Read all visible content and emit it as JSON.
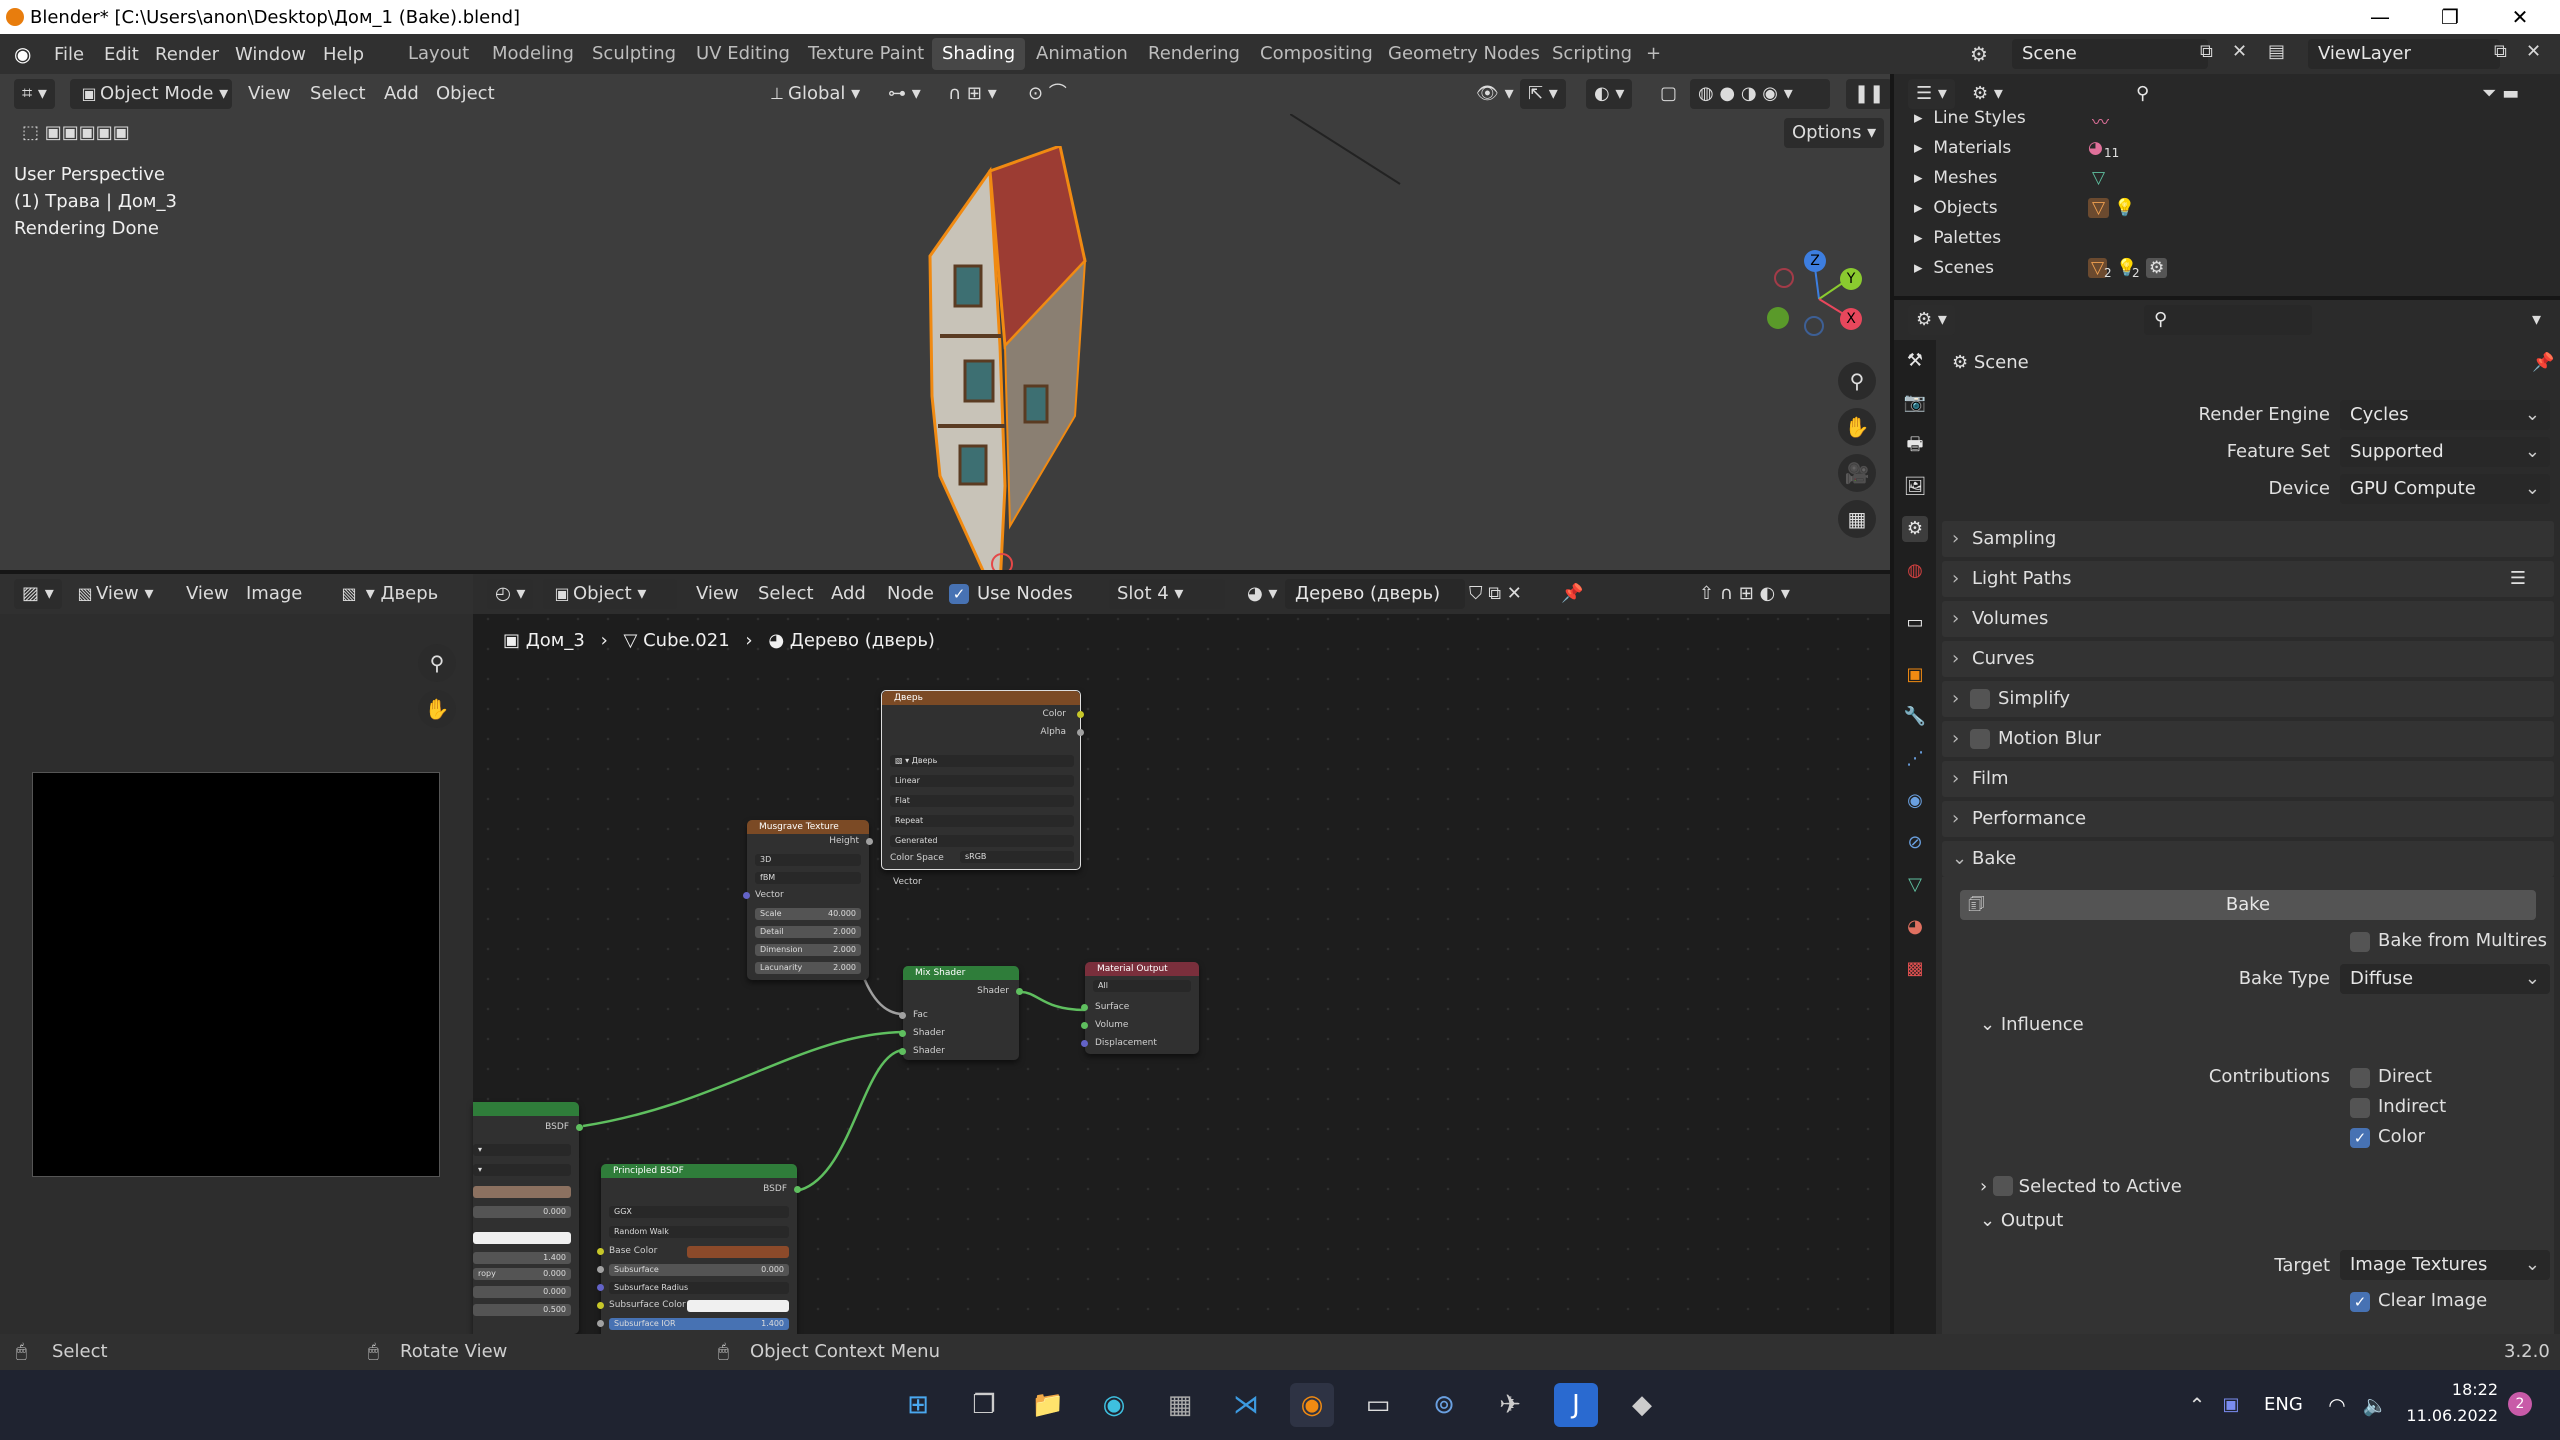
{
  "window": {
    "title": "Blender* [C:\\Users\\anon\\Desktop\\Дом_1 (Bake).blend]",
    "min": "—",
    "max": "❐",
    "close": "✕"
  },
  "menu": [
    "File",
    "Edit",
    "Render",
    "Window",
    "Help"
  ],
  "workspaces": [
    "Layout",
    "Modeling",
    "Sculpting",
    "UV Editing",
    "Texture Paint",
    "Shading",
    "Animation",
    "Rendering",
    "Compositing",
    "Geometry Nodes",
    "Scripting",
    "+"
  ],
  "active_workspace": "Shading",
  "scene": {
    "label": "Scene",
    "viewlayer": "ViewLayer"
  },
  "viewport": {
    "mode": "Object Mode",
    "menus": [
      "View",
      "Select",
      "Add",
      "Object"
    ],
    "orientation": "Global",
    "options": "Options",
    "overlay_lines": [
      "User Perspective",
      "(1) Трава | Дом_3",
      "Rendering Done"
    ],
    "gizmo": {
      "z": "Z",
      "y": "Y",
      "x": "X"
    }
  },
  "image_editor": {
    "menus": [
      "View",
      "View",
      "Image"
    ],
    "image_name": "Дверь"
  },
  "node_editor": {
    "type": "Object",
    "menus": [
      "View",
      "Select",
      "Add",
      "Node"
    ],
    "use_nodes": "Use Nodes",
    "slot": "Slot 4",
    "material": "Дерево (дверь)",
    "breadcrumb": [
      "Дом_3",
      "Cube.021",
      "Дерево (дверь)"
    ],
    "image_node": {
      "title": "Дверь",
      "outputs": [
        "Color",
        "Alpha"
      ],
      "image": "Дверь",
      "interp": "Linear",
      "proj": "Flat",
      "ext": "Repeat",
      "source": "Generated",
      "cs_label": "Color Space",
      "cs": "sRGB",
      "input": "Vector"
    },
    "musgrave": {
      "title": "Musgrave Texture",
      "output": "Height",
      "dim": "3D",
      "type": "fBM",
      "input": "Vector",
      "fields": [
        [
          "Scale",
          "40.000"
        ],
        [
          "Detail",
          "2.000"
        ],
        [
          "Dimension",
          "2.000"
        ],
        [
          "Lacunarity",
          "2.000"
        ]
      ]
    },
    "mix": {
      "title": "Mix Shader",
      "output": "Shader",
      "inputs": [
        "Fac",
        "Shader",
        "Shader"
      ]
    },
    "output": {
      "title": "Material Output",
      "target": "All",
      "inputs": [
        "Surface",
        "Volume",
        "Displacement"
      ]
    },
    "bsdf_partial": {
      "output": "BSDF",
      "values": [
        "0.000",
        "1.400",
        "0.000",
        "0.000",
        "0.500"
      ],
      "cut_label": "ropy"
    },
    "principled": {
      "title": "Principled BSDF",
      "output": "BSDF",
      "dist": "GGX",
      "sss": "Random Walk",
      "rows": [
        [
          "Base Color",
          ""
        ],
        [
          "Subsurface",
          "0.000"
        ],
        [
          "Subsurface Radius",
          ""
        ],
        [
          "Subsurface Color",
          ""
        ],
        [
          "Subsurface IOR",
          "1.400"
        ]
      ]
    }
  },
  "outliner": {
    "items": [
      "Line Styles",
      "Materials",
      "Meshes",
      "Objects",
      "Palettes",
      "Scenes"
    ],
    "badges": {
      "materials": "11",
      "scenes_a": "2",
      "scenes_b": "2"
    }
  },
  "properties": {
    "context": "Scene",
    "render_engine": {
      "label": "Render Engine",
      "value": "Cycles"
    },
    "feature_set": {
      "label": "Feature Set",
      "value": "Supported"
    },
    "device": {
      "label": "Device",
      "value": "GPU Compute"
    },
    "panels": [
      "Sampling",
      "Light Paths",
      "Volumes",
      "Curves",
      "Simplify",
      "Motion Blur",
      "Film",
      "Performance",
      "Bake"
    ],
    "bake": {
      "button": "Bake",
      "from_multires": "Bake from Multires",
      "type_label": "Bake Type",
      "type": "Diffuse",
      "influence": "Influence",
      "contrib_label": "Contributions",
      "direct": "Direct",
      "indirect": "Indirect",
      "color": "Color",
      "selected_to_active": "Selected to Active",
      "output": "Output",
      "target_label": "Target",
      "target": "Image Textures",
      "clear_image": "Clear Image"
    }
  },
  "status": {
    "select": "Select",
    "rotate": "Rotate View",
    "context": "Object Context Menu",
    "version": "3.2.0"
  },
  "taskbar": {
    "lang": "ENG",
    "time": "18:22",
    "date": "11.06.2022",
    "notif": "2"
  },
  "colors": {
    "accent": "#4772b3",
    "orange": "#e87d0d",
    "header": "#303030",
    "node_bg": "#1d1d1d"
  }
}
